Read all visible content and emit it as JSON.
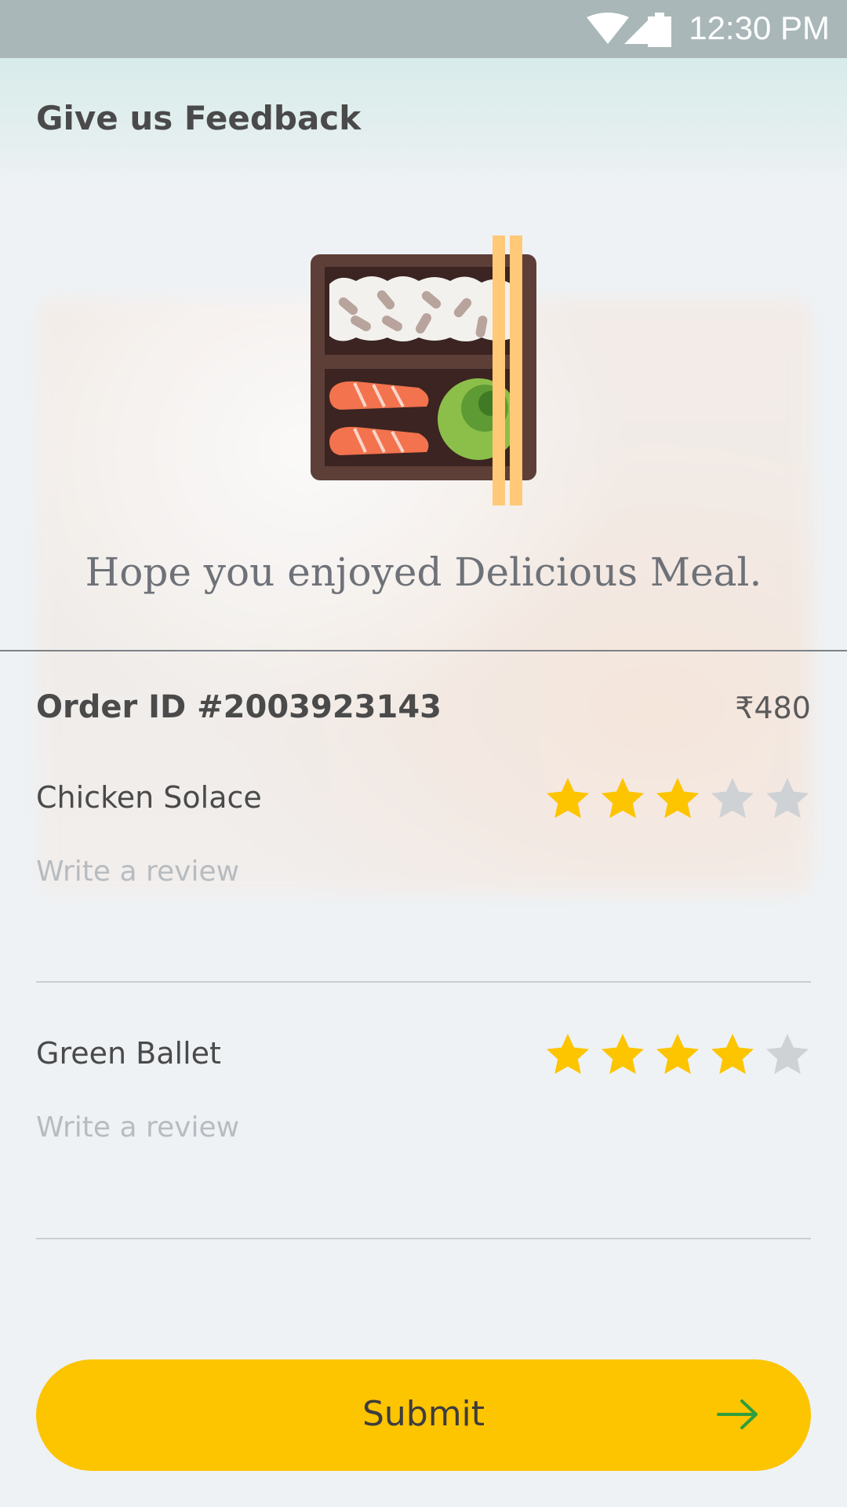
{
  "status_bar": {
    "time": "12:30 PM",
    "icons": [
      "wifi-icon",
      "signal-icon",
      "battery-icon"
    ]
  },
  "header": {
    "title": "Give us Feedback"
  },
  "hero": {
    "illustration": "bento-box-icon",
    "message": "Hope you enjoyed Delicious Meal."
  },
  "order": {
    "id_label": "Order ID #2003923143",
    "price": "₹480"
  },
  "items": [
    {
      "name": "Chicken Solace",
      "rating": 3,
      "max_rating": 5,
      "review_placeholder": "Write a review",
      "review_value": ""
    },
    {
      "name": "Green Ballet",
      "rating": 4,
      "max_rating": 5,
      "review_placeholder": "Write a review",
      "review_value": ""
    }
  ],
  "submit": {
    "label": "Submit",
    "icon": "arrow-right-icon"
  },
  "colors": {
    "star_filled": "#fdc400",
    "star_empty": "#cfd2d5",
    "submit_bg": "#fdc400",
    "arrow": "#2e9e3e"
  }
}
